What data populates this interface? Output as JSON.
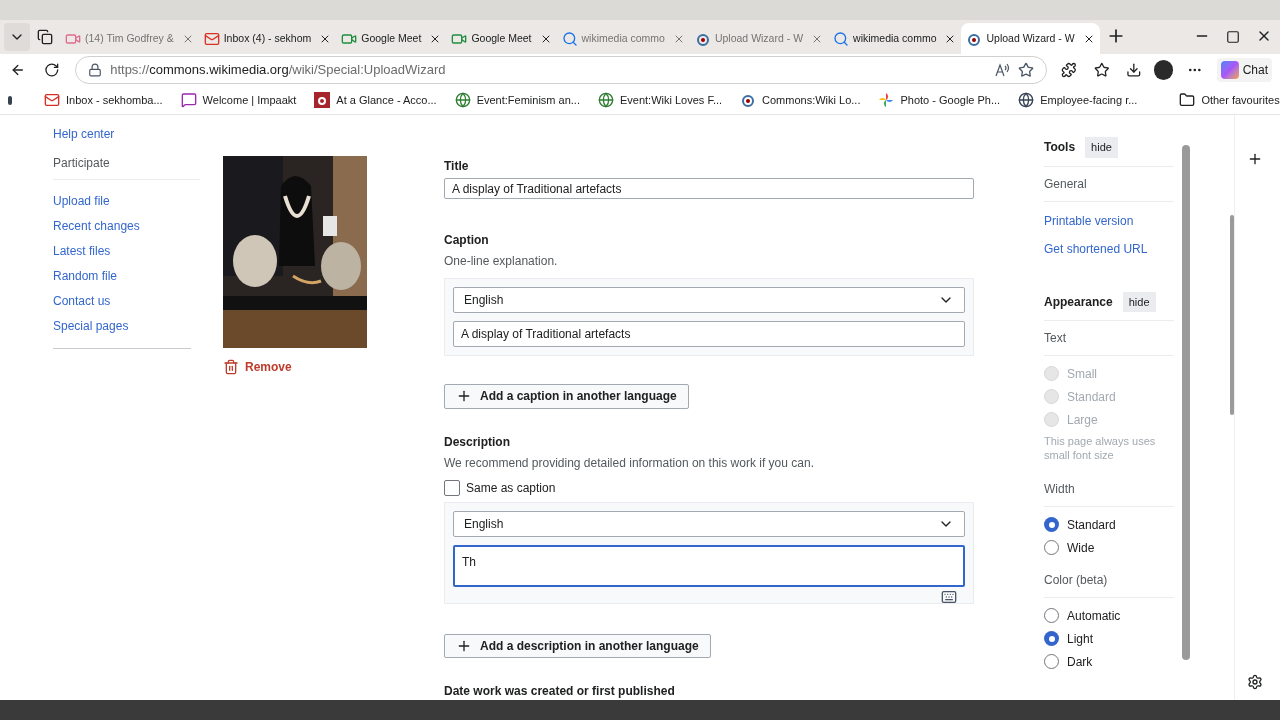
{
  "browser": {
    "tabs": [
      {
        "title": "(14) Tim Godfrey &",
        "kind": "video",
        "dimmed": true,
        "selected": false
      },
      {
        "title": "Inbox (4) - sekhom",
        "kind": "mail",
        "dimmed": false,
        "selected": false
      },
      {
        "title": "Google Meet",
        "kind": "meet",
        "dimmed": false,
        "selected": false
      },
      {
        "title": "Google Meet",
        "kind": "meet",
        "dimmed": false,
        "selected": false
      },
      {
        "title": "wikimedia commo",
        "kind": "search",
        "dimmed": true,
        "selected": false
      },
      {
        "title": "Upload Wizard - W",
        "kind": "commons",
        "dimmed": true,
        "selected": false
      },
      {
        "title": "wikimedia commo",
        "kind": "search",
        "dimmed": false,
        "selected": false
      },
      {
        "title": "Upload Wizard - W",
        "kind": "commons",
        "dimmed": false,
        "selected": true
      }
    ],
    "url": {
      "scheme": "https://",
      "host": "commons.wikimedia.org",
      "path": "/wiki/Special:UploadWizard"
    },
    "chat_label": "Chat",
    "bookmarks": [
      {
        "title": "Inbox - sekhomba...",
        "kind": "mail"
      },
      {
        "title": "Welcome | Impaakt",
        "kind": "chat"
      },
      {
        "title": "At a Glance - Acco...",
        "kind": "letter"
      },
      {
        "title": "Event:Feminism an...",
        "kind": "globe-green"
      },
      {
        "title": "Event:Wiki Loves F...",
        "kind": "globe-green"
      },
      {
        "title": "Commons:Wiki Lo...",
        "kind": "commons"
      },
      {
        "title": "Photo - Google Ph...",
        "kind": "pinwheel"
      },
      {
        "title": "Employee-facing r...",
        "kind": "globe"
      }
    ],
    "other_favourites": "Other favourites"
  },
  "sidebar": {
    "items": [
      {
        "label": "Help center",
        "kind": "link"
      },
      {
        "label": "Participate",
        "kind": "heading"
      },
      {
        "label": "Upload file",
        "kind": "link"
      },
      {
        "label": "Recent changes",
        "kind": "link"
      },
      {
        "label": "Latest files",
        "kind": "link"
      },
      {
        "label": "Random file",
        "kind": "link"
      },
      {
        "label": "Contact us",
        "kind": "link"
      },
      {
        "label": "Special pages",
        "kind": "link"
      }
    ]
  },
  "upload": {
    "remove_label": "Remove",
    "title": {
      "label": "Title",
      "value": "A display of Traditional artefacts"
    },
    "caption": {
      "label": "Caption",
      "hint": "One-line explanation.",
      "language": "English",
      "value": "A display of Traditional artefacts"
    },
    "add_caption_button": "Add a caption in another language",
    "description": {
      "label": "Description",
      "hint": "We recommend providing detailed information on this work if you can.",
      "same_as_caption": {
        "label": "Same as caption",
        "checked": false
      },
      "language": "English",
      "value": "Th",
      "focused": true
    },
    "add_description_button": "Add a description in another language",
    "date_label": "Date work was created or first published"
  },
  "tools": {
    "title": "Tools",
    "hide": "hide",
    "general": "General",
    "links": [
      "Printable version",
      "Get shortened URL"
    ],
    "appearance": {
      "title": "Appearance",
      "hide": "hide",
      "groups": [
        {
          "label": "Text",
          "disabled": true,
          "options": [
            {
              "label": "Small",
              "selected": false
            },
            {
              "label": "Standard",
              "selected": false
            },
            {
              "label": "Large",
              "selected": false
            }
          ],
          "note": "This page always uses small font size"
        },
        {
          "label": "Width",
          "disabled": false,
          "options": [
            {
              "label": "Standard",
              "selected": true
            },
            {
              "label": "Wide",
              "selected": false
            }
          ]
        },
        {
          "label": "Color (beta)",
          "disabled": false,
          "options": [
            {
              "label": "Automatic",
              "selected": false
            },
            {
              "label": "Light",
              "selected": true
            },
            {
              "label": "Dark",
              "selected": false
            }
          ]
        }
      ]
    }
  }
}
